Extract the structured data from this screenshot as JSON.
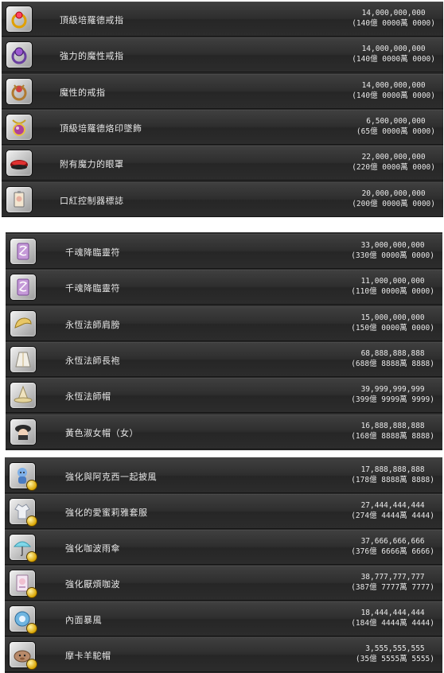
{
  "groups": [
    {
      "items": [
        {
          "icon": "gold-ring-icon",
          "name": "頂級培羅德戒指",
          "price": "14,000,000,000",
          "price_detail": "(140億 0000萬 0000)"
        },
        {
          "icon": "purple-ring-icon",
          "name": "強力的魔性戒指",
          "price": "14,000,000,000",
          "price_detail": "(140億 0000萬 0000)"
        },
        {
          "icon": "demon-ring-icon",
          "name": "魔性的戒指",
          "price": "14,000,000,000",
          "price_detail": "(140億 0000萬 0000)"
        },
        {
          "icon": "gem-pendant-icon",
          "name": "頂級培羅德烙印墜飾",
          "price": "6,500,000,000",
          "price_detail": "(65億 0000萬 0000)"
        },
        {
          "icon": "red-eyepatch-icon",
          "name": "附有魔力的眼罩",
          "price": "22,000,000,000",
          "price_detail": "(220億 0000萬 0000)"
        },
        {
          "icon": "badge-tag-icon",
          "name": "口紅控制器標誌",
          "price": "20,000,000,000",
          "price_detail": "(200億 0000萬 0000)"
        }
      ]
    },
    {
      "items": [
        {
          "icon": "talisman-icon",
          "name": "千魂降臨靈符",
          "price": "33,000,000,000",
          "price_detail": "(330億 0000萬 0000)"
        },
        {
          "icon": "talisman-icon",
          "name": "千魂降臨靈符",
          "price": "11,000,000,000",
          "price_detail": "(110億 0000萬 0000)"
        },
        {
          "icon": "shoulder-pad-icon",
          "name": "永恆法師肩膀",
          "price": "15,000,000,000",
          "price_detail": "(150億 0000萬 0000)"
        },
        {
          "icon": "robe-icon",
          "name": "永恆法師長袍",
          "price": "68,888,888,888",
          "price_detail": "(688億 8888萬 8888)"
        },
        {
          "icon": "wizard-hat-icon",
          "name": "永恆法師帽",
          "price": "39,999,999,999",
          "price_detail": "(399億 9999萬 9999)"
        },
        {
          "icon": "witch-hat-icon",
          "name": "黃色淑女帽（女）",
          "price": "16,888,888,888",
          "price_detail": "(168億 8888萬 8888)"
        }
      ]
    },
    {
      "items": [
        {
          "icon": "blue-doll-icon",
          "name": "強化與阿克西一起披風",
          "price": "17,888,888,888",
          "price_detail": "(178億 8888萬 8888)"
        },
        {
          "icon": "outfit-icon",
          "name": "強化的愛蜜莉雅套服",
          "price": "27,444,444,444",
          "price_detail": "(274億 4444萬 4444)"
        },
        {
          "icon": "umbrella-icon",
          "name": "強化咖波雨傘",
          "price": "37,666,666,666",
          "price_detail": "(376億 6666萬 6666)"
        },
        {
          "icon": "card-icon",
          "name": "強化厭煩咖波",
          "price": "38,777,777,777",
          "price_detail": "(387億 7777萬 7777)"
        },
        {
          "icon": "blue-cape-icon",
          "name": "內面暴風",
          "price": "18,444,444,444",
          "price_detail": "(184億 4444萬 4444)"
        },
        {
          "icon": "alpaca-hat-icon",
          "name": "摩卡羊駝帽",
          "price": "3,555,555,555",
          "price_detail": "(35億 5555萬 5555)"
        }
      ]
    }
  ],
  "colors": {
    "panel_bg": "#2a2a2a",
    "text": "#e8e8e8",
    "coin_badge": "#d9a400"
  }
}
